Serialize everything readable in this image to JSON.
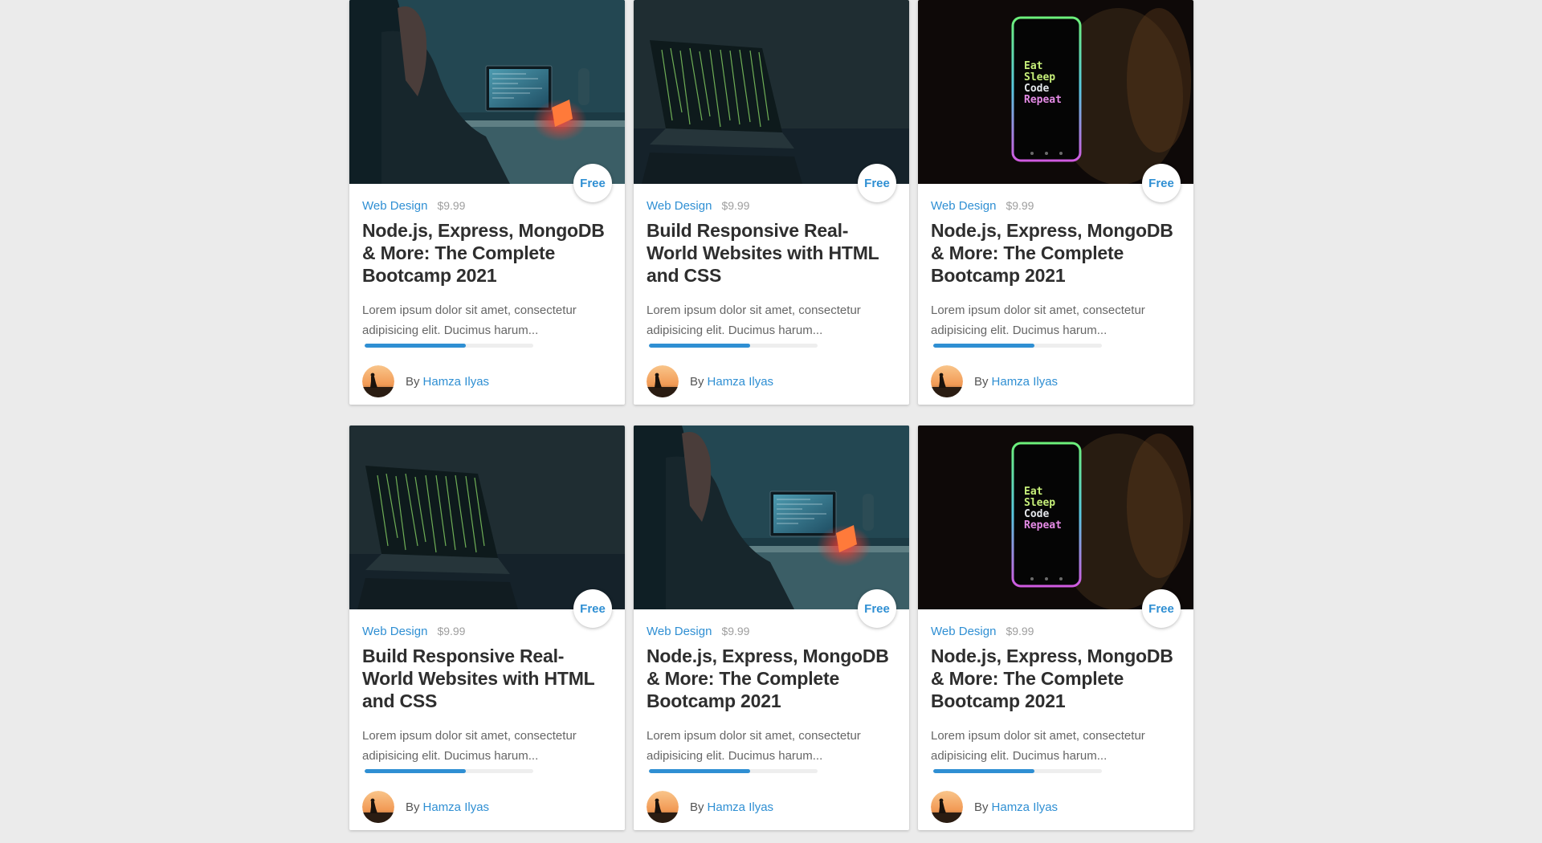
{
  "courses": [
    {
      "image": "woman-at-laptop-photo",
      "badge": "Free",
      "category": "Web Design",
      "price": "$9.99",
      "title": "Node.js, Express, MongoDB & More: The Complete Bootcamp 2021",
      "description": "Lorem ipsum dolor sit amet, consectetur adipisicing elit. Ducimus harum...",
      "progress": 0.6,
      "by_label": "By",
      "author": "Hamza Ilyas"
    },
    {
      "image": "laptop-code-matrix-photo",
      "badge": "Free",
      "category": "Web Design",
      "price": "$9.99",
      "title": "Build Responsive Real-World Websites with HTML and CSS",
      "description": "Lorem ipsum dolor sit amet, consectetur adipisicing elit. Ducimus harum...",
      "progress": 0.6,
      "by_label": "By",
      "author": "Hamza Ilyas"
    },
    {
      "image": "phone-eat-sleep-code-photo",
      "badge": "Free",
      "category": "Web Design",
      "price": "$9.99",
      "title": "Node.js, Express, MongoDB & More: The Complete Bootcamp 2021",
      "description": "Lorem ipsum dolor sit amet, consectetur adipisicing elit. Ducimus harum...",
      "progress": 0.6,
      "by_label": "By",
      "author": "Hamza Ilyas"
    },
    {
      "image": "laptop-code-matrix-photo",
      "badge": "Free",
      "category": "Web Design",
      "price": "$9.99",
      "title": "Build Responsive Real-World Websites with HTML and CSS",
      "description": "Lorem ipsum dolor sit amet, consectetur adipisicing elit. Ducimus harum...",
      "progress": 0.6,
      "by_label": "By",
      "author": "Hamza Ilyas"
    },
    {
      "image": "woman-at-laptop-photo",
      "badge": "Free",
      "category": "Web Design",
      "price": "$9.99",
      "title": "Node.js, Express, MongoDB & More: The Complete Bootcamp 2021",
      "description": "Lorem ipsum dolor sit amet, consectetur adipisicing elit. Ducimus harum...",
      "progress": 0.6,
      "by_label": "By",
      "author": "Hamza Ilyas"
    },
    {
      "image": "phone-eat-sleep-code-photo",
      "badge": "Free",
      "category": "Web Design",
      "price": "$9.99",
      "title": "Node.js, Express, MongoDB & More: The Complete Bootcamp 2021",
      "description": "Lorem ipsum dolor sit amet, consectetur adipisicing elit. Ducimus harum...",
      "progress": 0.6,
      "by_label": "By",
      "author": "Hamza Ilyas"
    }
  ],
  "phone_screen_text": [
    "Eat",
    "Sleep",
    "Code",
    "Repeat"
  ],
  "colors": {
    "accent": "#2f8fd3",
    "background": "#ebebeb",
    "title": "#2e2e2e"
  }
}
